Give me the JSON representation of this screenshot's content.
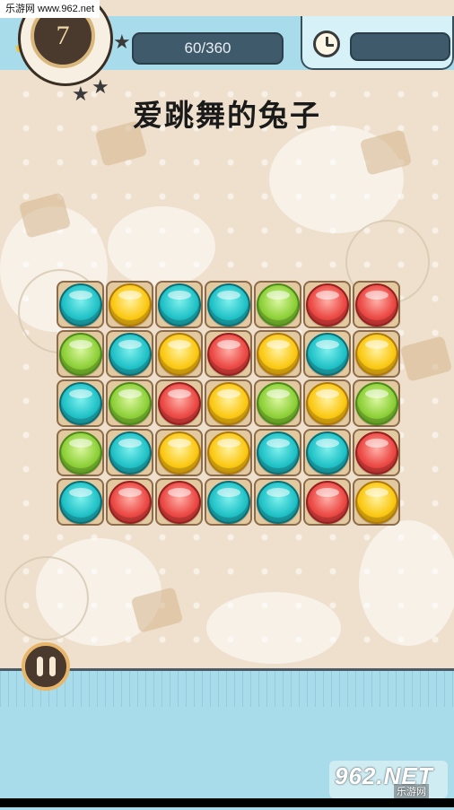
{
  "watermark_top": "乐游网 www.962.net",
  "level": "7",
  "score": "60/360",
  "title": "爱跳舞的兔子",
  "board": [
    [
      "teal",
      "yellow",
      "teal",
      "teal",
      "green",
      "red",
      "red"
    ],
    [
      "green",
      "teal",
      "yellow",
      "red",
      "yellow",
      "teal",
      "yellow"
    ],
    [
      "teal",
      "green",
      "red",
      "yellow",
      "green",
      "yellow",
      "green"
    ],
    [
      "green",
      "teal",
      "yellow",
      "yellow",
      "teal",
      "teal",
      "red"
    ],
    [
      "teal",
      "red",
      "red",
      "teal",
      "teal",
      "red",
      "yellow"
    ]
  ],
  "colors": {
    "teal": "#22c3c8",
    "yellow": "#fbc915",
    "green": "#8fd13a",
    "red": "#ec4a45",
    "header": "#a9dceb"
  },
  "watermark_logo": {
    "big": "962.NET",
    "small": "乐游网"
  }
}
